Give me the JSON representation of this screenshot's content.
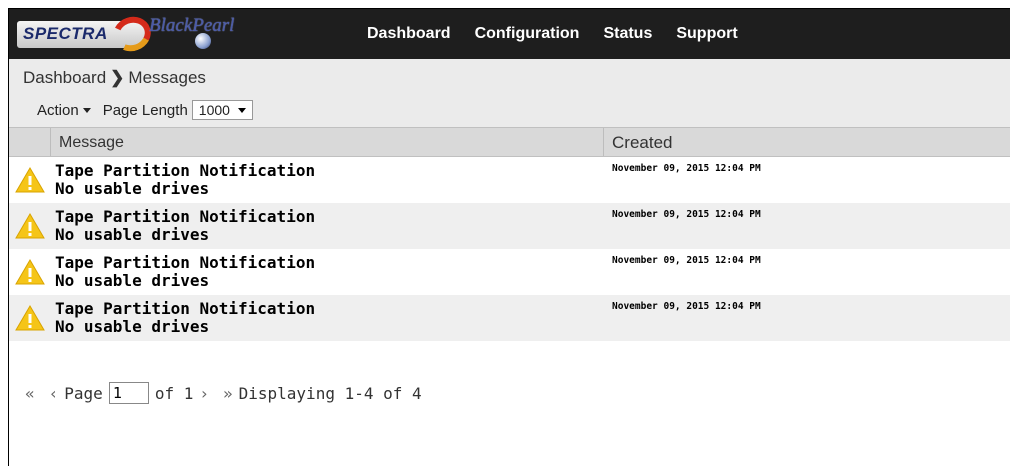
{
  "brand": {
    "primary_logo_text": "SPECTRA",
    "product_logo_text": "BlackPearl"
  },
  "nav": {
    "items": [
      {
        "label": "Dashboard"
      },
      {
        "label": "Configuration"
      },
      {
        "label": "Status"
      },
      {
        "label": "Support"
      }
    ]
  },
  "breadcrumb": {
    "parent": "Dashboard",
    "current": "Messages"
  },
  "toolbar": {
    "action_label": "Action",
    "page_length_label": "Page Length",
    "page_length_value": "1000"
  },
  "table": {
    "columns": [
      "Message",
      "Created"
    ],
    "rows": [
      {
        "title": "Tape Partition Notification",
        "detail": "No usable drives",
        "created": "November 09, 2015 12:04 PM",
        "icon": "warning-icon"
      },
      {
        "title": "Tape Partition Notification",
        "detail": "No usable drives",
        "created": "November 09, 2015 12:04 PM",
        "icon": "warning-icon"
      },
      {
        "title": "Tape Partition Notification",
        "detail": "No usable drives",
        "created": "November 09, 2015 12:04 PM",
        "icon": "warning-icon"
      },
      {
        "title": "Tape Partition Notification",
        "detail": "No usable drives",
        "created": "November 09, 2015 12:04 PM",
        "icon": "warning-icon"
      }
    ]
  },
  "pager": {
    "first_glyph": "«",
    "prev_glyph": "‹",
    "page_label": "Page",
    "page_value": "1",
    "of_label": "of 1",
    "next_glyph": "›",
    "last_glyph": "»",
    "display_text": "Displaying 1-4 of 4"
  },
  "colors": {
    "topbar": "#1e1e1e",
    "header_bg": "#ebebeb",
    "row_alt": "#efefef",
    "warning": "#f5c518"
  }
}
